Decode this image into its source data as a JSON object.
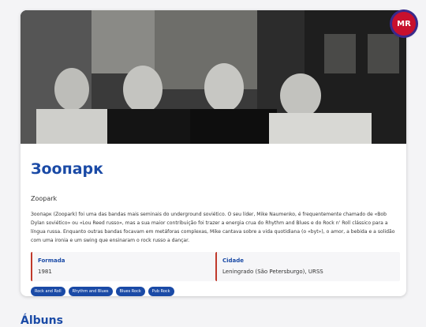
{
  "band": {
    "name": "Зоопарк",
    "alt_name": "Zoopark",
    "logo_text": "MR",
    "description": "Зоопарк (Zoopark) foi uma das bandas mais seminais do underground soviético. O seu líder, Mike Naumenko, é frequentemente chamado de «Bob Dylan soviético» ou «Lou Reed russo», mas a sua maior contribuição foi trazer a energia crua do Rhythm and Blues e do Rock n' Roll clássico para a língua russa. Enquanto outras bandas focavam em metáforas complexas, Mike cantava sobre a vida quotidiana (o «byt»), o amor, a bebida e a solidão com uma ironia e um swing que ensinaram o rock russo a dançar."
  },
  "info": {
    "formed_label": "Formada",
    "formed_value": "1981",
    "city_label": "Cidade",
    "city_value": "Leningrado (São Petersburgo), URSS"
  },
  "tags": [
    "Rock and Roll",
    "Rhythm and Blues",
    "Blues Rock",
    "Pub Rock"
  ],
  "sections": {
    "albums_heading": "Álbuns"
  },
  "colors": {
    "accent": "#1a4aa6",
    "info_border": "#c0392b",
    "logo": "#c8102e"
  }
}
